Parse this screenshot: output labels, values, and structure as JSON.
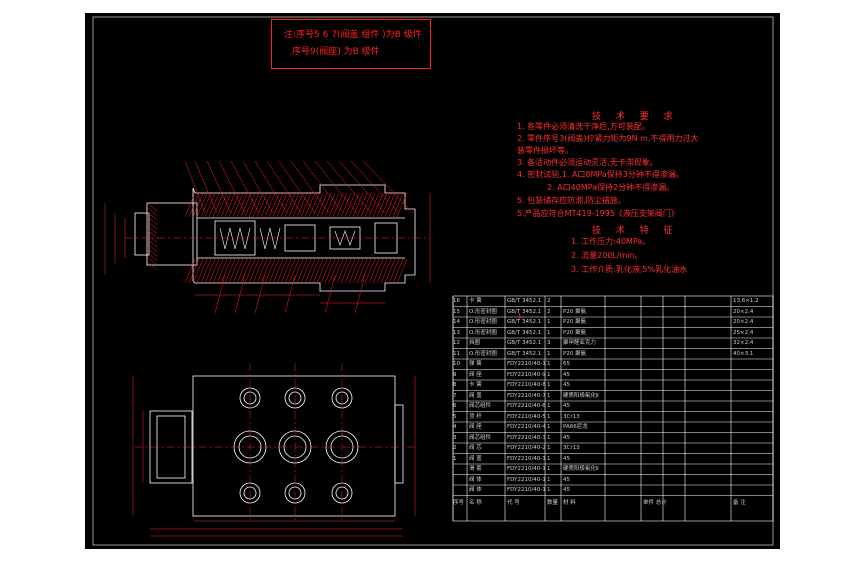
{
  "colors": {
    "background": "#000000",
    "page": "#ffffff",
    "note": "#ff2020",
    "outline": "#ffffff",
    "hatch": "#ff2020",
    "dimension": "#ff2020",
    "centerline": "#ff2020"
  },
  "note": {
    "line1": "注:序号5 6 7(阀盖 组件 )为B 级件",
    "line2": "序号9(阀座)      为B 级件"
  },
  "technical_requirements": {
    "title": "技 术 要 求",
    "items": [
      "1. 各零件必须清洗干净后,方可装配。",
      "2. 零件序号3(阀盖)拧紧力矩为9N·m,不得用力过大",
      "装零件损坏等。",
      "3. 各活动件必须运动灵活,无卡滞现象。",
      "4. 密封试验,1. A口8MPa保持3分钟不得渗漏。",
      "2. A口40MPa保持2分钟不得渗漏。",
      "5. 包装储存应防潮,防尘措施。",
      "5.产品应符合MT419-1995《液压支架阀门》"
    ]
  },
  "technical_specs": {
    "title": "技 术 特 征",
    "items": [
      "1. 工作压力:40MPa。",
      "2. 流量200L/min。",
      "3. 工作介质:乳化液,5%乳化油水"
    ]
  },
  "extra_text": ")。",
  "bom": {
    "rows": [
      {
        "no": "16",
        "name": "卡  簧",
        "code": "GB/T 3452.1",
        "qty": "2",
        "material": "",
        "note": "13.6×1.2"
      },
      {
        "no": "15",
        "name": "O.形密封圈",
        "code": "GB/T 3452.1",
        "qty": "2",
        "material": "P20 聚氨",
        "note": "20×2.4"
      },
      {
        "no": "14",
        "name": "O.形密封圈",
        "code": "GB/T 3452.1",
        "qty": "1",
        "material": "P20 聚氨",
        "note": "20×2.4"
      },
      {
        "no": "13",
        "name": "O.形密封圈",
        "code": "GB/T 3452.1",
        "qty": "1",
        "material": "P20 聚氨",
        "note": "25×2.4"
      },
      {
        "no": "12",
        "name": "挡圈",
        "code": "GB/T 3452.1",
        "qty": "3",
        "material": "聚甲醛亚克力",
        "note": "32×2.4"
      },
      {
        "no": "11",
        "name": "O.形密封圈",
        "code": "GB/T 3452.1",
        "qty": "1",
        "material": "P20 聚氨",
        "note": "40×3.1"
      },
      {
        "no": "10",
        "name": "弹  簧",
        "code": "FDY2210/40-11",
        "qty": "1",
        "material": "65",
        "note": ""
      },
      {
        "no": "9",
        "name": "阀  座",
        "code": "FDY2210/40-9",
        "qty": "1",
        "material": "45",
        "note": ""
      },
      {
        "no": "8",
        "name": "卡  簧",
        "code": "FDY2210/40-8",
        "qty": "1",
        "material": "45",
        "note": ""
      },
      {
        "no": "7",
        "name": "阀  盖",
        "code": "FDY2210/40-7",
        "qty": "1",
        "material": "硬质阳极氧化Ⅱ",
        "note": ""
      },
      {
        "no": "6",
        "name": "阀芯组件",
        "code": "FDY2210/40-6",
        "qty": "1",
        "material": "45",
        "note": ""
      },
      {
        "no": "5",
        "name": "顶  杆",
        "code": "FDY2210/40-5",
        "qty": "1",
        "material": "3Cr13",
        "note": ""
      },
      {
        "no": "4",
        "name": "阀  座",
        "code": "FDY2210/40-4",
        "qty": "1",
        "material": "PA66尼龙",
        "note": ""
      },
      {
        "no": "3",
        "name": "阀芯组件",
        "code": "FDY2210/40-3",
        "qty": "1",
        "material": "45",
        "note": ""
      },
      {
        "no": "2",
        "name": "阀  芯",
        "code": "FDY2210/40-2",
        "qty": "1",
        "material": "3Cr13",
        "note": ""
      },
      {
        "no": "1",
        "name": "阀  盖",
        "code": "FDY2210/40-1",
        "qty": "1",
        "material": "45",
        "note": ""
      },
      {
        "no": "",
        "name": "滑  套",
        "code": "FDY2210/40-1",
        "qty": "1",
        "material": "硬质阳极氧化Ⅱ",
        "note": ""
      },
      {
        "no": "",
        "name": "阀  体",
        "code": "FDY2210/40-1",
        "qty": "1",
        "material": "45",
        "note": ""
      },
      {
        "no": "",
        "name": "阀  体",
        "code": "FDY2210/40-1",
        "qty": "1",
        "material": "45",
        "note": ""
      }
    ],
    "header": {
      "no": "序号",
      "name": "名    称",
      "code": "代    号",
      "qty": "数量",
      "material": "材    料",
      "weight": "单件  总计",
      "weight_sub": "重  量",
      "note": "备    注"
    }
  },
  "dimension_labels": {
    "top_left": "φ",
    "bottom_overall": "183"
  }
}
